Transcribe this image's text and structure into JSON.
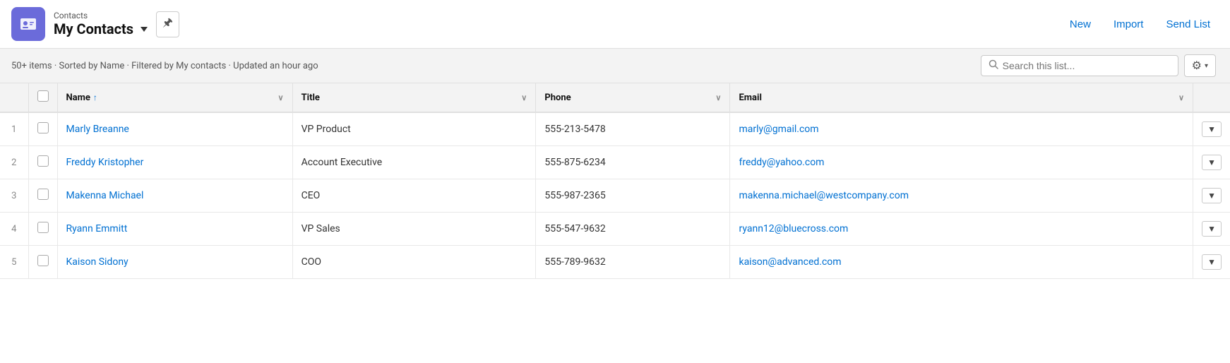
{
  "header": {
    "app_label": "Contacts",
    "title": "My Contacts",
    "pin_icon": "📌",
    "buttons": {
      "new": "New",
      "import": "Import",
      "send_list": "Send List"
    }
  },
  "subheader": {
    "info": "50+ items · Sorted by Name · Filtered by My contacts · Updated an hour ago",
    "search_placeholder": "Search this list...",
    "gear_icon": "⚙"
  },
  "table": {
    "columns": [
      {
        "key": "num",
        "label": ""
      },
      {
        "key": "check",
        "label": ""
      },
      {
        "key": "name",
        "label": "Name",
        "sort": "asc",
        "sort_icon": "↑"
      },
      {
        "key": "title",
        "label": "Title"
      },
      {
        "key": "phone",
        "label": "Phone"
      },
      {
        "key": "email",
        "label": "Email"
      },
      {
        "key": "action",
        "label": ""
      }
    ],
    "rows": [
      {
        "num": "1",
        "name": "Marly Breanne",
        "title": "VP Product",
        "phone": "555-213-5478",
        "email": "marly@gmail.com"
      },
      {
        "num": "2",
        "name": "Freddy Kristopher",
        "title": "Account Executive",
        "phone": "555-875-6234",
        "email": "freddy@yahoo.com"
      },
      {
        "num": "3",
        "name": "Makenna Michael",
        "title": "CEO",
        "phone": "555-987-2365",
        "email": "makenna.michael@westcompany.com"
      },
      {
        "num": "4",
        "name": "Ryann Emmitt",
        "title": "VP Sales",
        "phone": "555-547-9632",
        "email": "ryann12@bluecross.com"
      },
      {
        "num": "5",
        "name": "Kaison Sidony",
        "title": "COO",
        "phone": "555-789-9632",
        "email": "kaison@advanced.com"
      }
    ]
  },
  "icons": {
    "contacts_icon": "👤",
    "chevron_down": "▼",
    "sort_asc": "↑",
    "col_chevron": "∨",
    "search": "🔍",
    "gear": "⚙",
    "pin": "🖈",
    "row_dropdown": "▼"
  }
}
